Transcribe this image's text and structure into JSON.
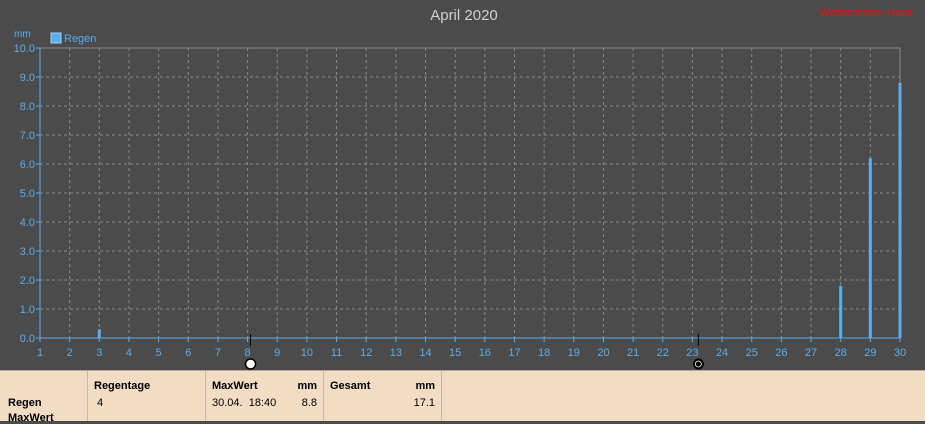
{
  "chart_data": {
    "type": "bar",
    "title": "April 2020",
    "ylabel": "mm",
    "xlim": [
      1,
      30
    ],
    "ylim": [
      0,
      10
    ],
    "x_ticks": [
      1,
      2,
      3,
      4,
      5,
      6,
      7,
      8,
      9,
      10,
      11,
      12,
      13,
      14,
      15,
      16,
      17,
      18,
      19,
      20,
      21,
      22,
      23,
      24,
      25,
      26,
      27,
      28,
      29,
      30
    ],
    "y_ticks": [
      "0.0",
      "1.0",
      "2.0",
      "3.0",
      "4.0",
      "5.0",
      "6.0",
      "7.0",
      "8.0",
      "9.0",
      "10.0"
    ],
    "grid": true,
    "legend_position": "top-left",
    "series": [
      {
        "name": "Regen",
        "color": "#5aaeee",
        "points": [
          {
            "x": 3.0,
            "y": 0.3
          },
          {
            "x": 28.0,
            "y": 1.8
          },
          {
            "x": 29.0,
            "y": 6.2
          },
          {
            "x": 30.0,
            "y": 8.8
          }
        ]
      }
    ],
    "moon_phases": [
      {
        "day": 8.1,
        "phase": "full-moon"
      },
      {
        "day": 23.2,
        "phase": "new-moon"
      }
    ]
  },
  "watermark": "Wetterstation Hans",
  "colors": {
    "background": "#4b4b4b",
    "text": "#5aaeee",
    "grid": "#8a8a8a",
    "title": "#cfcfcf",
    "watermark": "#ee1111"
  },
  "summary": {
    "row_labels": [
      "Regen",
      "MaxWert"
    ],
    "regentage_header": "Regentage",
    "regentage_value": "4",
    "maxwert_header": "MaxWert",
    "maxwert_unit": "mm",
    "maxwert_date": "30.04.  18:40",
    "maxwert_value": "8.8",
    "gesamt_header": "Gesamt",
    "gesamt_unit": "mm",
    "gesamt_value": "17.1"
  }
}
